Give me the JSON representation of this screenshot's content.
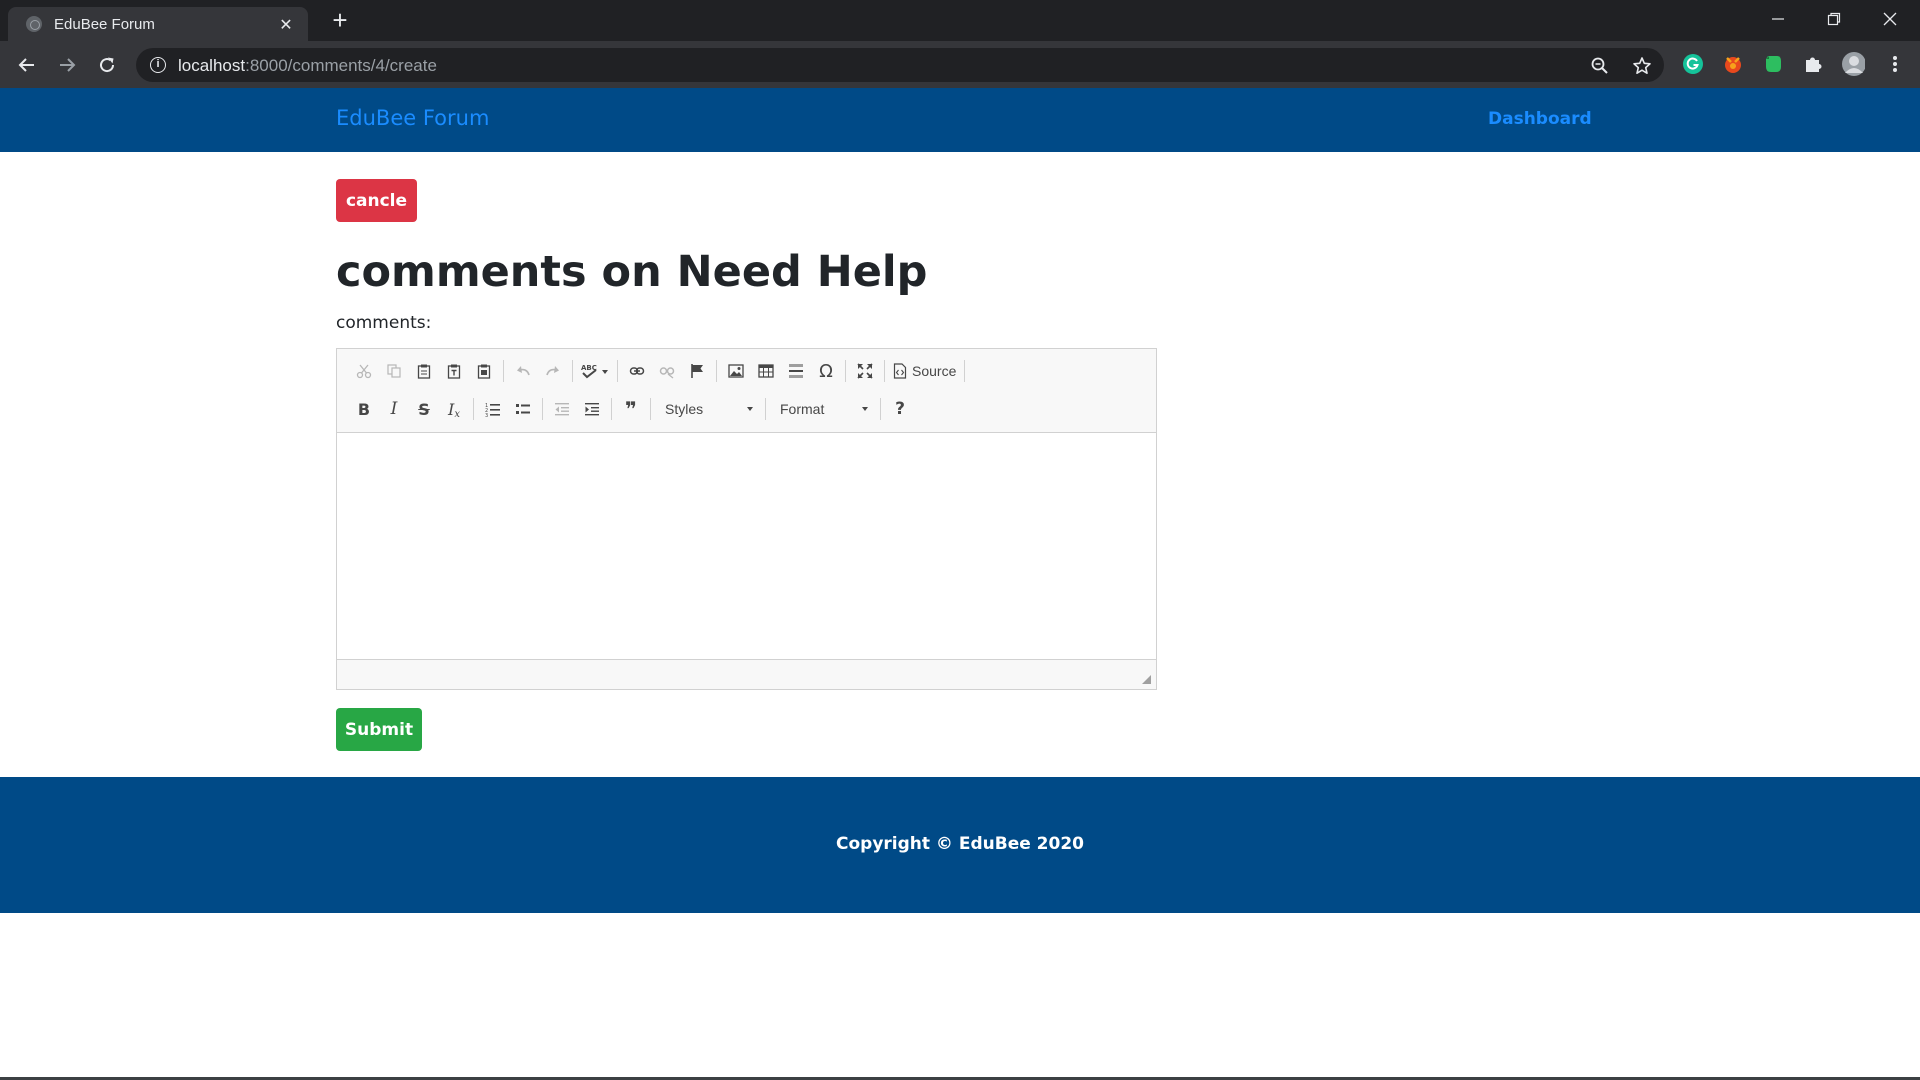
{
  "browser": {
    "tab_title": "EduBee Forum",
    "tab_close": "✕",
    "new_tab": "+",
    "url_host": "localhost",
    "url_path": ":8000/comments/4/create",
    "info_glyph": "i",
    "icons": [
      "back-arrow-icon",
      "forward-arrow-icon",
      "reload-icon",
      "info-icon",
      "zoom-icon",
      "star-icon",
      "grammarly-icon",
      "extension-fox-icon",
      "evernote-icon",
      "puzzle-icon",
      "profile-icon",
      "more-menu-icon"
    ],
    "colors": {
      "frame": "#202124",
      "toolbar": "#35363a",
      "url_host": "#e8eaed",
      "url_path": "#9aa0a6",
      "grammarly": "#15c39a",
      "evernote": "#2dbe60"
    }
  },
  "navbar": {
    "brand": "EduBee Forum",
    "dashboard_link": "Dashboard"
  },
  "page": {
    "cancel_label": "cancle",
    "title": "comments on Need Help",
    "field_label": "comments:",
    "submit_label": "Submit"
  },
  "editor": {
    "row1": [
      "cut",
      "copy",
      "paste",
      "paste-text",
      "paste-from-word",
      "undo",
      "redo",
      "spellcheck",
      "link",
      "unlink",
      "anchor",
      "image",
      "table",
      "horizontal-line",
      "special-char",
      "maximize",
      "source"
    ],
    "row2": [
      "bold",
      "italic",
      "strike",
      "remove-format",
      "numbered-list",
      "bulleted-list",
      "outdent",
      "indent",
      "blockquote",
      "styles",
      "format",
      "about"
    ],
    "glyphs": {
      "bold": "B",
      "italic": "I",
      "strike": "S",
      "remove_format": "I",
      "remove_format_sub": "x",
      "special_char": "Ω",
      "about": "?",
      "blockquote": "❞"
    },
    "source_label": "Source",
    "styles_label": "Styles",
    "format_label": "Format",
    "content": ""
  },
  "footer": {
    "copyright": "Copyright © EduBee 2020"
  },
  "theme": {
    "navbar_bg": "#004a87",
    "link_color": "#1a8cff",
    "cancel_bg": "#dc3545",
    "submit_bg": "#28a745",
    "text_dark": "#212529"
  }
}
